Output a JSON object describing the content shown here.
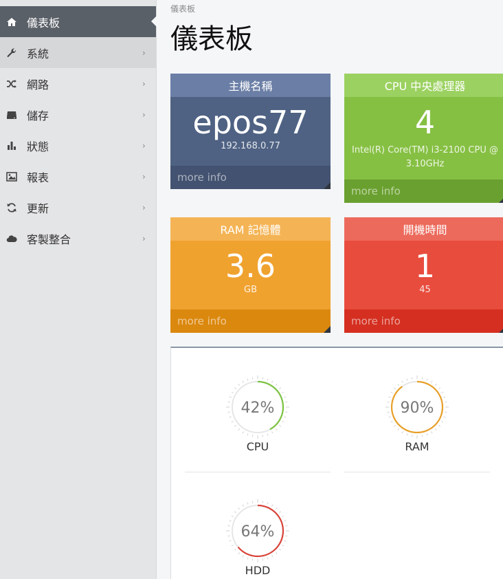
{
  "sidebar": {
    "items": [
      {
        "label": "儀表板",
        "icon": "home-icon"
      },
      {
        "label": "系統",
        "icon": "wrench-icon"
      },
      {
        "label": "網路",
        "icon": "shuffle-icon"
      },
      {
        "label": "儲存",
        "icon": "drive-icon"
      },
      {
        "label": "狀態",
        "icon": "bar-chart-icon"
      },
      {
        "label": "報表",
        "icon": "image-icon"
      },
      {
        "label": "更新",
        "icon": "refresh-icon"
      },
      {
        "label": "客製整合",
        "icon": "cloud-icon"
      }
    ],
    "chevron": "›"
  },
  "breadcrumb": "儀表板",
  "page_title": "儀表板",
  "cards": {
    "host": {
      "title": "主機名稱",
      "value": "epos77",
      "sub": "192.168.0.77",
      "footer": "more info"
    },
    "cpu": {
      "title": "CPU 中央處理器",
      "value": "4",
      "sub": "Intel(R) Core(TM) i3-2100 CPU @ 3.10GHz",
      "footer": "more info"
    },
    "ram": {
      "title": "RAM 記憶體",
      "value": "3.6",
      "sub": "GB",
      "footer": "more info"
    },
    "uptime": {
      "title": "開機時間",
      "value": "1",
      "sub": "45",
      "footer": "more info"
    }
  },
  "gauges": [
    {
      "label": "CPU",
      "percent": 42,
      "text": "42%",
      "color": "#7cc242"
    },
    {
      "label": "RAM",
      "percent": 90,
      "text": "90%",
      "color": "#e8a02a"
    },
    {
      "label": "HDD",
      "percent": 64,
      "text": "64%",
      "color": "#d9443a"
    }
  ],
  "colors": {
    "sidebar_active": "#5a6068",
    "host": "#4f6283",
    "cpu": "#86c043",
    "ram": "#f0a22f",
    "uptime": "#e84c3d"
  }
}
